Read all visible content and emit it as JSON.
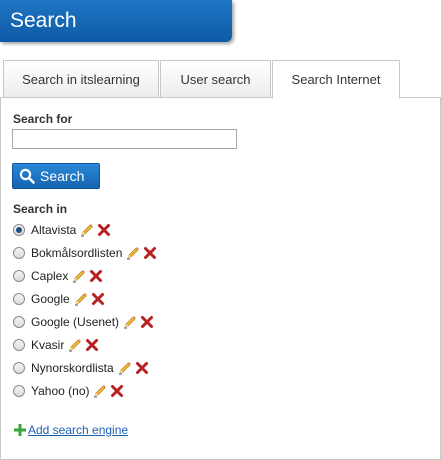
{
  "header": {
    "title": "Search"
  },
  "tabs": [
    {
      "label": "Search in itslearning",
      "active": false
    },
    {
      "label": "User search",
      "active": false
    },
    {
      "label": "Search Internet",
      "active": true
    }
  ],
  "form": {
    "search_for_label": "Search for",
    "search_value": "",
    "search_button_label": "Search",
    "search_in_label": "Search in"
  },
  "engines": [
    {
      "name": "Altavista",
      "selected": true
    },
    {
      "name": "Bokmålsordlisten",
      "selected": false
    },
    {
      "name": "Caplex",
      "selected": false
    },
    {
      "name": "Google",
      "selected": false
    },
    {
      "name": "Google (Usenet)",
      "selected": false
    },
    {
      "name": "Kvasir",
      "selected": false
    },
    {
      "name": "Nynorskordlista",
      "selected": false
    },
    {
      "name": "Yahoo (no)",
      "selected": false
    }
  ],
  "add_engine_label": "Add search engine",
  "colors": {
    "header": "#1565b5",
    "link": "#1a5fb4",
    "delete": "#b52020",
    "plus": "#3aa23a"
  },
  "icons": {
    "edit": "pencil-icon",
    "delete": "delete-x-icon",
    "add": "plus-icon",
    "search": "magnifier-icon"
  }
}
